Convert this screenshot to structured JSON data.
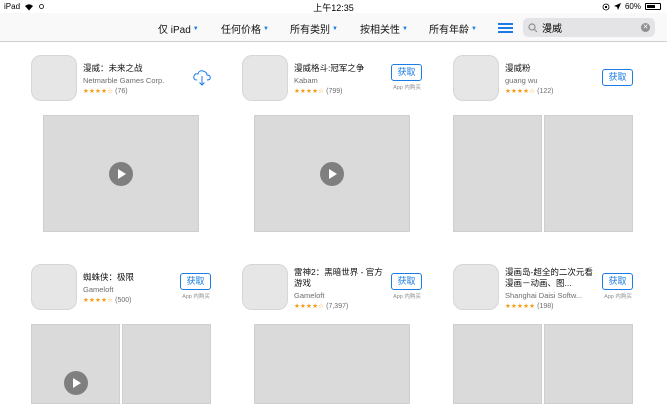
{
  "status": {
    "device": "iPad",
    "time": "上午12:35",
    "battery": "60%"
  },
  "filters": {
    "device": "仅 iPad",
    "price": "任何价格",
    "category": "所有类别",
    "sort": "按相关性",
    "age": "所有年龄"
  },
  "search": {
    "query": "漫威"
  },
  "colors": {
    "accent": "#1a7ce4",
    "star": "#f39c12"
  },
  "apps": [
    {
      "title": "漫威：未来之战",
      "developer": "Netmarble Games Corp.",
      "rating_count": "(76)",
      "stars": "★★★★☆",
      "action": "cloud-download"
    },
    {
      "title": "漫威格斗:冠军之争",
      "developer": "Kabam",
      "rating_count": "(799)",
      "stars": "★★★★☆",
      "button": "获取",
      "iap": "App 内购买"
    },
    {
      "title": "漫威粉",
      "developer": "guang wu",
      "rating_count": "(122)",
      "stars": "★★★★☆",
      "button": "获取"
    },
    {
      "title": "蜘蛛侠：极限",
      "developer": "Gameloft",
      "rating_count": "(500)",
      "stars": "★★★★☆",
      "button": "获取",
      "iap": "App 内购买"
    },
    {
      "title": "雷神2：黑暗世界 - 官方游戏",
      "developer": "Gameloft",
      "rating_count": "(7,397)",
      "stars": "★★★★☆",
      "button": "获取",
      "iap": "App 内购买"
    },
    {
      "title": "漫画岛-超全的二次元看漫画－动画、图...",
      "developer": "Shanghai Daisi Softw...",
      "rating_count": "(198)",
      "stars": "★★★★★",
      "button": "获取",
      "iap": "App 内购买"
    }
  ]
}
